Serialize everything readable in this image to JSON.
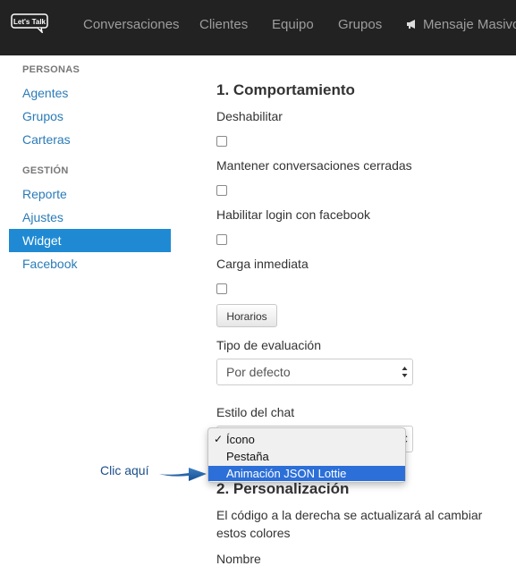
{
  "nav": {
    "logo_text": "Let's Talk",
    "items": [
      "Conversaciones",
      "Clientes",
      "Equipo",
      "Grupos"
    ],
    "mass_message": "Mensaje Masivo",
    "mass_message_icon": "megaphone-icon"
  },
  "sidebar": {
    "section_people": "PERSONAS",
    "people_items": [
      "Agentes",
      "Grupos",
      "Carteras"
    ],
    "section_management": "GESTIÓN",
    "management_items": [
      "Reporte",
      "Ajustes",
      "Widget",
      "Facebook"
    ],
    "active_item": "Widget"
  },
  "main": {
    "section1_title": "1. Comportamiento",
    "fields": {
      "disable": "Deshabilitar",
      "keep_closed": "Mantener conversaciones cerradas",
      "facebook_login": "Habilitar login con facebook",
      "immediate_load": "Carga inmediata"
    },
    "schedule_button": "Horarios",
    "evaluation_label": "Tipo de evaluación",
    "evaluation_value": "Por defecto",
    "chat_style_label": "Estilo del chat",
    "chat_style_options": [
      "Ícono",
      "Pestaña",
      "Animación JSON Lottie"
    ],
    "chat_style_checked": "Ícono",
    "chat_style_highlighted": "Animación JSON Lottie",
    "section2_title": "2. Personalización",
    "section2_text": "El código a la derecha se actualizará al cambiar estos colores",
    "next_label": "Nombre"
  },
  "annotation": {
    "text": "Clic aquí"
  },
  "colors": {
    "navbar": "#222222",
    "active_sidebar": "#1f8ad3",
    "link": "#2a7bb8",
    "dropdown_highlight": "#2c6fd8",
    "annotation": "#1a4f8a"
  }
}
